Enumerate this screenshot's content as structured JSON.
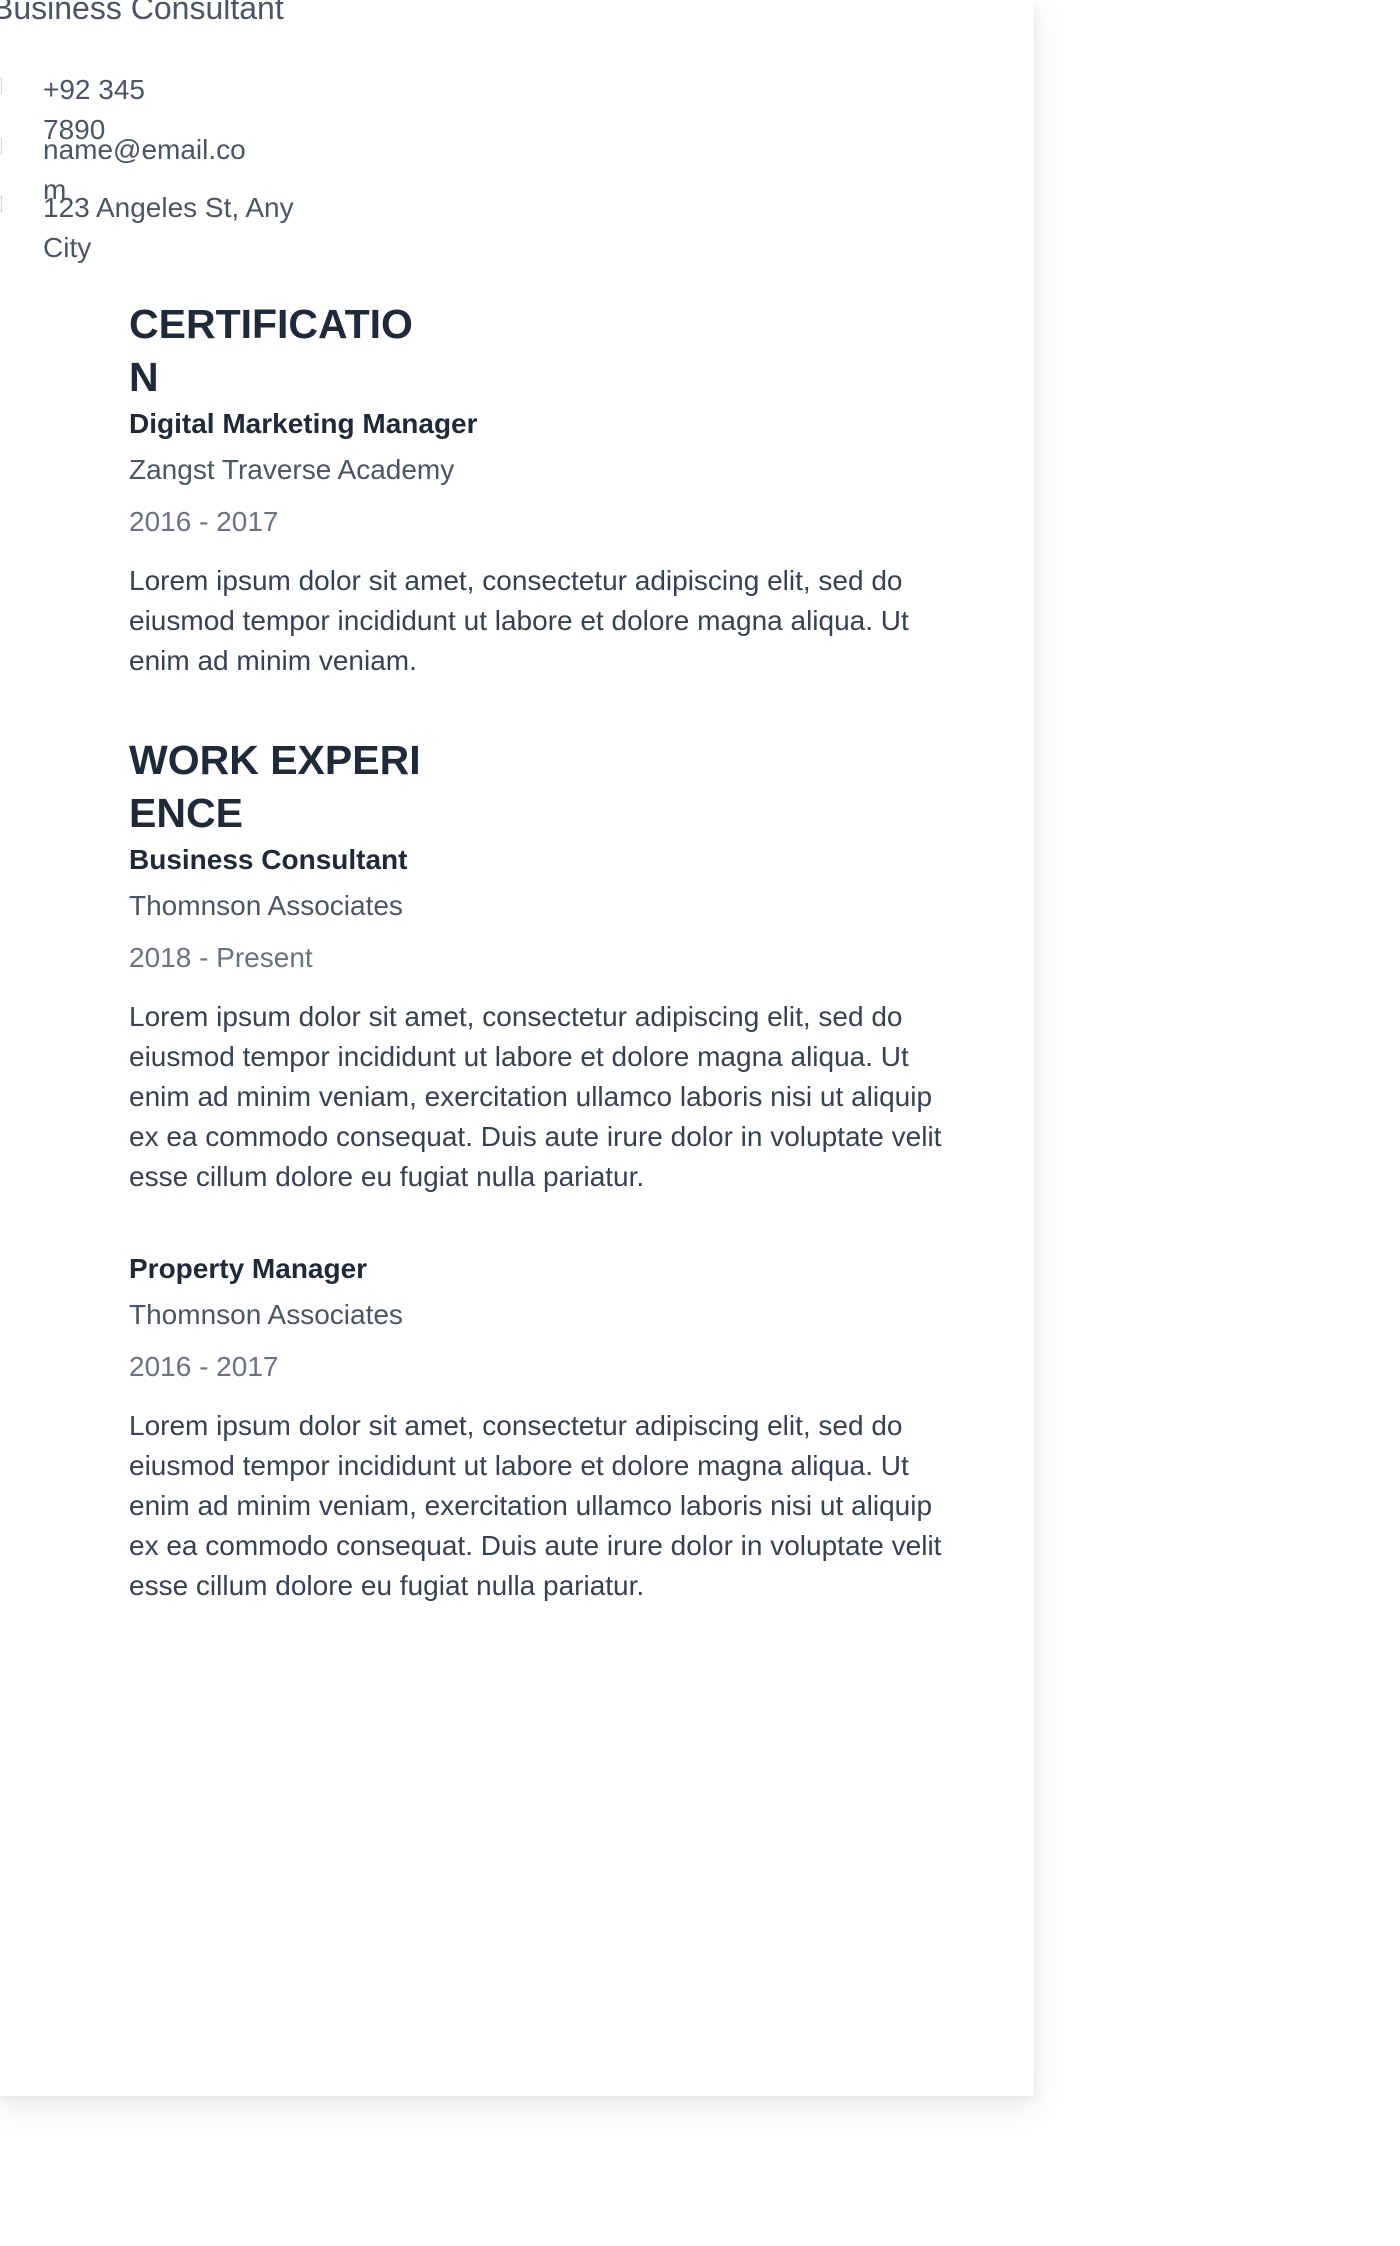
{
  "header": {
    "subtitle": "Business Consultant"
  },
  "contact": {
    "phone": {
      "icon": "phone-icon",
      "text": "+92 345 7890"
    },
    "email": {
      "icon": "email-icon",
      "text": "name@email.com"
    },
    "address": {
      "icon": "location-icon",
      "text": "123 Angeles St, Any City"
    }
  },
  "certification": {
    "title": "CERTIFICATION",
    "items": [
      {
        "title": "Digital Marketing Manager",
        "org": "Zangst Traverse Academy",
        "dates": "2016 - 2017",
        "description": "Lorem ipsum dolor sit amet, consectetur adipiscing elit, sed do eiusmod tempor incididunt ut labore et dolore magna aliqua. Ut enim ad minim veniam."
      }
    ]
  },
  "work_experience": {
    "title": "WORK EXPERIENCE",
    "items": [
      {
        "title": "Business Consultant",
        "org": "Thomnson Associates",
        "dates": "2018 - Present",
        "description": "Lorem ipsum dolor sit amet, consectetur adipiscing elit, sed do eiusmod tempor incididunt ut labore et dolore magna aliqua. Ut enim ad minim veniam, exercitation ullamco laboris nisi ut aliquip ex ea commodo consequat. Duis aute irure dolor in voluptate velit esse cillum dolore eu fugiat nulla pariatur."
      },
      {
        "title": "Property Manager",
        "org": "Thomnson Associates",
        "dates": "2016 - 2017",
        "description": "Lorem ipsum dolor sit amet, consectetur adipiscing elit, sed do eiusmod tempor incididunt ut labore et dolore magna aliqua. Ut enim ad minim veniam, exercitation ullamco laboris nisi ut aliquip ex ea commodo consequat. Duis aute irure dolor in voluptate velit esse cillum dolore eu fugiat nulla pariatur."
      }
    ]
  }
}
